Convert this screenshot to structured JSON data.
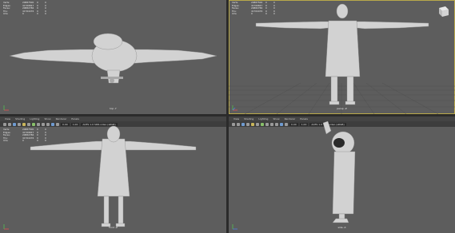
{
  "hud": {
    "rows": [
      {
        "label": "Verts:",
        "value": "20887500",
        "a": "0",
        "b": "0"
      },
      {
        "label": "Edges:",
        "value": "41769847",
        "a": "0",
        "b": "0"
      },
      {
        "label": "Faces:",
        "value": "20882786",
        "a": "0",
        "b": "0"
      },
      {
        "label": "Tris:",
        "value": "41764476",
        "a": "0",
        "b": "0"
      },
      {
        "label": "UVs:",
        "value": "0",
        "a": "0",
        "b": "0"
      }
    ]
  },
  "menus": [
    "View",
    "Shading",
    "Lighting",
    "Show",
    "Renderer",
    "Panels"
  ],
  "toolbar": {
    "exposure": "0.00",
    "gamma": "1.00",
    "colorspace": "ACES 1.0 SDR-video (sRGB)"
  },
  "viewports": {
    "top": {
      "label": "top -Y"
    },
    "persp": {
      "label": "persp -Z"
    },
    "front": {
      "label": "front -Z"
    },
    "side": {
      "label": "side -X"
    }
  },
  "viewcube": {
    "label": "FRONT"
  },
  "colors": {
    "viewport_bg": "#5d5d5d",
    "selection_outline": "#b9a84a",
    "model": "#d4d4d4"
  }
}
